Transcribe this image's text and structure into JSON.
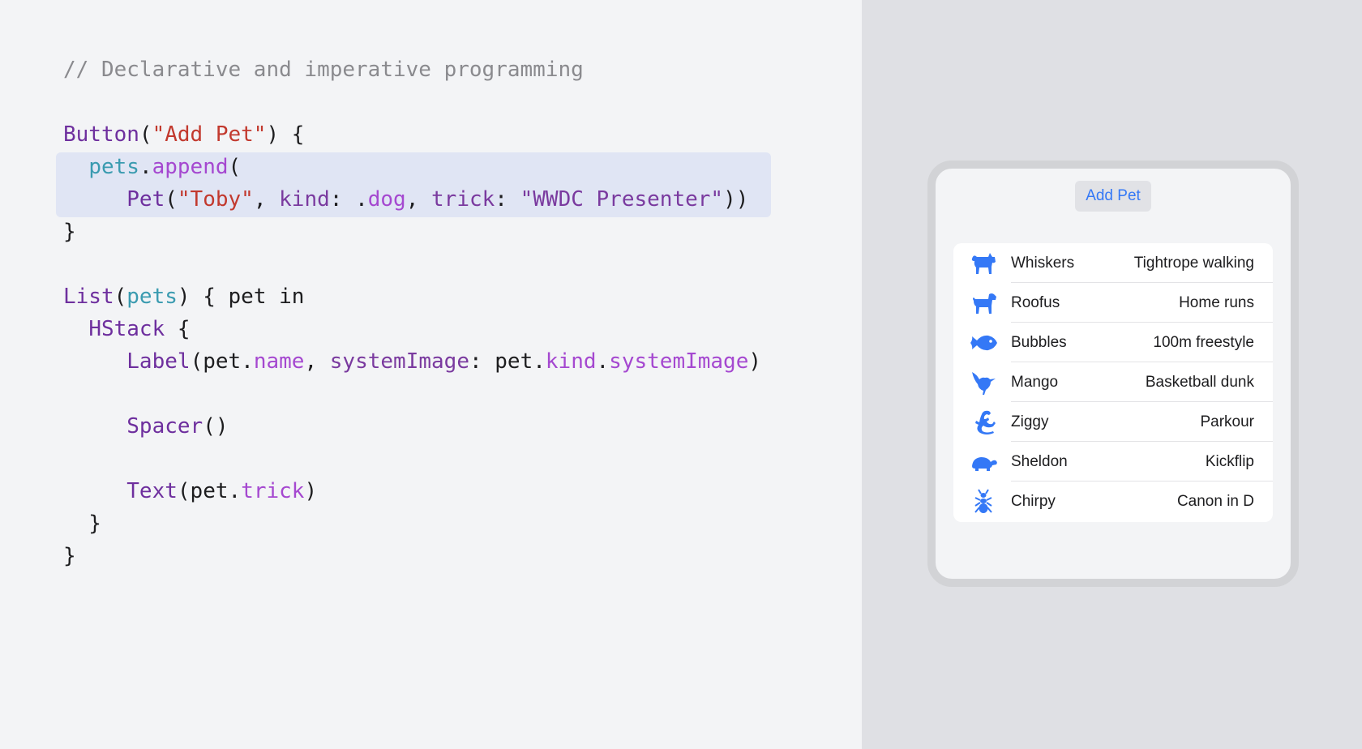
{
  "code": {
    "comment": "// Declarative and imperative programming",
    "lines": [
      [
        [
          "c-type",
          "Button"
        ],
        [
          "c-plain",
          "("
        ],
        [
          "c-str",
          "\"Add Pet\""
        ],
        [
          "c-plain",
          ") {"
        ]
      ],
      [
        [
          "c-plain",
          "  "
        ],
        [
          "c-var",
          "pets"
        ],
        [
          "c-plain",
          "."
        ],
        [
          "c-member",
          "append"
        ],
        [
          "c-plain",
          "("
        ]
      ],
      [
        [
          "c-plain",
          "     "
        ],
        [
          "c-type",
          "Pet"
        ],
        [
          "c-plain",
          "("
        ],
        [
          "c-str",
          "\"Toby\""
        ],
        [
          "c-plain",
          ", "
        ],
        [
          "c-label",
          "kind"
        ],
        [
          "c-plain",
          ": ."
        ],
        [
          "c-member",
          "dog"
        ],
        [
          "c-plain",
          ", "
        ],
        [
          "c-label",
          "trick"
        ],
        [
          "c-plain",
          ": "
        ],
        [
          "c-label",
          "\"WWDC Presenter\""
        ],
        [
          "c-plain",
          "))"
        ]
      ],
      [
        [
          "c-plain",
          "}"
        ]
      ],
      [],
      [
        [
          "c-type",
          "List"
        ],
        [
          "c-plain",
          "("
        ],
        [
          "c-var",
          "pets"
        ],
        [
          "c-plain",
          ") { pet in"
        ]
      ],
      [
        [
          "c-plain",
          "  "
        ],
        [
          "c-type",
          "HStack"
        ],
        [
          "c-plain",
          " {"
        ]
      ],
      [
        [
          "c-plain",
          "     "
        ],
        [
          "c-type",
          "Label"
        ],
        [
          "c-plain",
          "(pet."
        ],
        [
          "c-member",
          "name"
        ],
        [
          "c-plain",
          ", "
        ],
        [
          "c-label",
          "systemImage"
        ],
        [
          "c-plain",
          ": pet."
        ],
        [
          "c-member",
          "kind"
        ],
        [
          "c-plain",
          "."
        ],
        [
          "c-member",
          "systemImage"
        ],
        [
          "c-plain",
          ")"
        ]
      ],
      [],
      [
        [
          "c-plain",
          "     "
        ],
        [
          "c-type",
          "Spacer"
        ],
        [
          "c-plain",
          "()"
        ]
      ],
      [],
      [
        [
          "c-plain",
          "     "
        ],
        [
          "c-type",
          "Text"
        ],
        [
          "c-plain",
          "(pet."
        ],
        [
          "c-member",
          "trick"
        ],
        [
          "c-plain",
          ")"
        ]
      ],
      [
        [
          "c-plain",
          "  }"
        ]
      ],
      [
        [
          "c-plain",
          "}"
        ]
      ]
    ]
  },
  "preview": {
    "add_button_label": "Add Pet",
    "accent_color": "#3478f6",
    "pets": [
      {
        "name": "Whiskers",
        "trick": "Tightrope walking",
        "icon": "cat-icon"
      },
      {
        "name": "Roofus",
        "trick": "Home runs",
        "icon": "dog-icon"
      },
      {
        "name": "Bubbles",
        "trick": "100m freestyle",
        "icon": "fish-icon"
      },
      {
        "name": "Mango",
        "trick": "Basketball dunk",
        "icon": "bird-icon"
      },
      {
        "name": "Ziggy",
        "trick": "Parkour",
        "icon": "lizard-icon"
      },
      {
        "name": "Sheldon",
        "trick": "Kickflip",
        "icon": "tortoise-icon"
      },
      {
        "name": "Chirpy",
        "trick": "Canon in D",
        "icon": "ant-icon"
      }
    ]
  }
}
